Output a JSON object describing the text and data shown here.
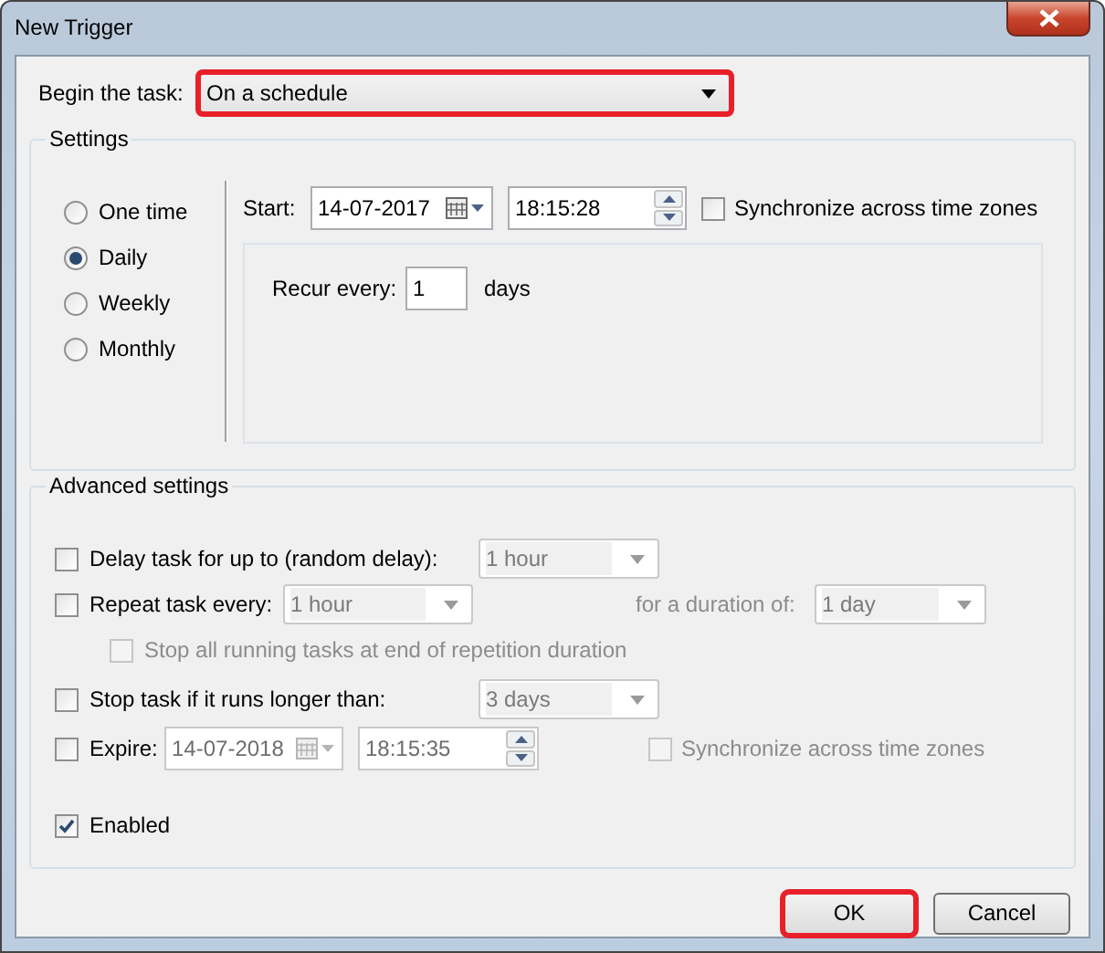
{
  "window": {
    "title": "New Trigger"
  },
  "begin": {
    "label": "Begin the task:",
    "value": "On a schedule",
    "highlighted": true
  },
  "settings": {
    "title": "Settings",
    "schedule": [
      {
        "label": "One time",
        "selected": false
      },
      {
        "label": "Daily",
        "selected": true
      },
      {
        "label": "Weekly",
        "selected": false
      },
      {
        "label": "Monthly",
        "selected": false
      }
    ],
    "start": {
      "label": "Start:",
      "date": "14-07-2017",
      "time": "18:15:28"
    },
    "sync": {
      "label": "Synchronize across time zones",
      "checked": false,
      "disabled": false
    },
    "recur": {
      "label": "Recur every:",
      "value": "1",
      "unit": "days"
    }
  },
  "advanced": {
    "title": "Advanced settings",
    "delay": {
      "label": "Delay task for up to (random delay):",
      "checked": false,
      "value": "1 hour",
      "disabled": true
    },
    "repeat": {
      "label": "Repeat task every:",
      "checked": false,
      "value": "1 hour",
      "disabled": true,
      "duration_label": "for a duration of:",
      "duration_value": "1 day"
    },
    "stop_all": {
      "label": "Stop all running tasks at end of repetition duration",
      "checked": false,
      "disabled": true
    },
    "stop_task": {
      "label": "Stop task if it runs longer than:",
      "checked": false,
      "value": "3 days",
      "disabled": true
    },
    "expire": {
      "label": "Expire:",
      "checked": false,
      "date": "14-07-2018",
      "time": "18:15:35",
      "disabled": true
    },
    "expire_sync": {
      "label": "Synchronize across time zones",
      "checked": false,
      "disabled": true
    },
    "enabled": {
      "label": "Enabled",
      "checked": true,
      "disabled": false
    }
  },
  "buttons": [
    {
      "label": "OK",
      "highlighted": true
    },
    {
      "label": "Cancel",
      "highlighted": false
    }
  ]
}
